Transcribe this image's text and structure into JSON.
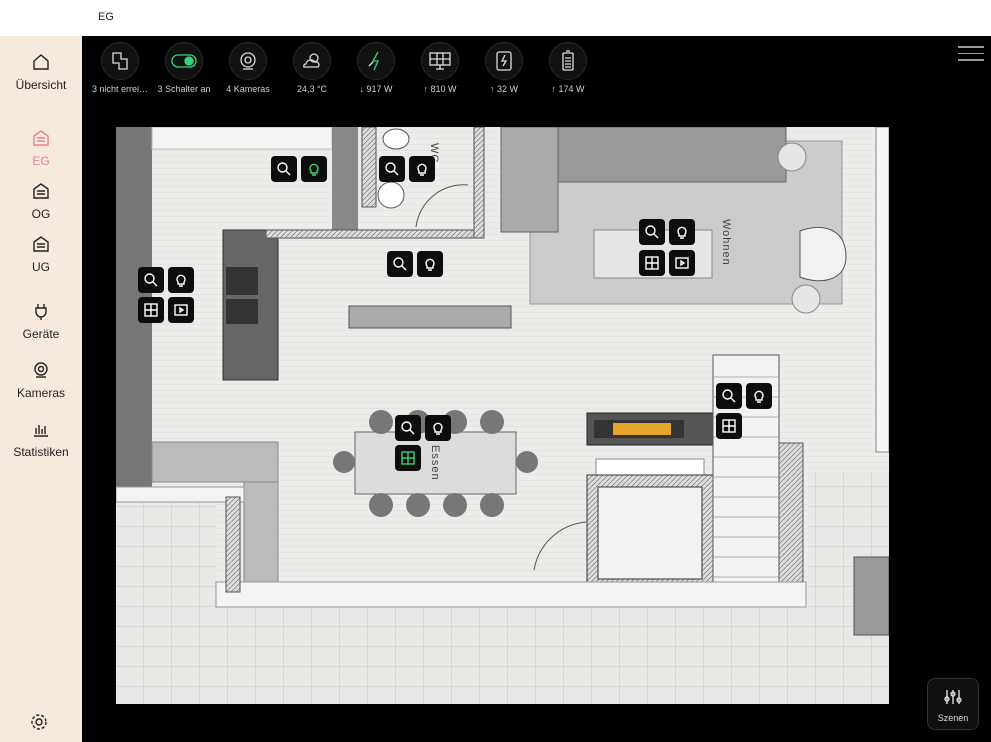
{
  "window": {
    "title": "EG"
  },
  "sidebar": {
    "items": [
      {
        "label": "Übersicht",
        "icon": "home-icon"
      },
      {
        "label": "EG",
        "icon": "floor-icon",
        "active": true
      },
      {
        "label": "OG",
        "icon": "floor-icon"
      },
      {
        "label": "UG",
        "icon": "floor-icon"
      },
      {
        "label": "Geräte",
        "icon": "plug-icon"
      },
      {
        "label": "Kameras",
        "icon": "camera-icon"
      },
      {
        "label": "Statistiken",
        "icon": "chart-icon"
      }
    ],
    "settings_icon": "gear-icon",
    "active_color": "#e8828f"
  },
  "status": [
    {
      "label": "3 nicht errei…",
      "icon": "devices-offline-icon"
    },
    {
      "label": "3 Schalter an",
      "icon": "toggle-icon"
    },
    {
      "label": "4 Kameras",
      "icon": "webcam-icon"
    },
    {
      "label": "24,3 °C",
      "icon": "weather-icon"
    },
    {
      "label": "↓ 917 W",
      "icon": "grid-power-icon"
    },
    {
      "label": "↑ 810 W",
      "icon": "solar-panel-icon"
    },
    {
      "label": "↑ 32 W",
      "icon": "wallbox-icon"
    },
    {
      "label": "↑ 174 W",
      "icon": "battery-icon"
    }
  ],
  "rooms": {
    "wohnen": "Wohnen",
    "essen": "Essen",
    "wc": "WC"
  },
  "scenes": {
    "label": "Szenen"
  },
  "colors": {
    "accent_on": "#39d37a",
    "sidebar_bg": "#f6eadf"
  }
}
